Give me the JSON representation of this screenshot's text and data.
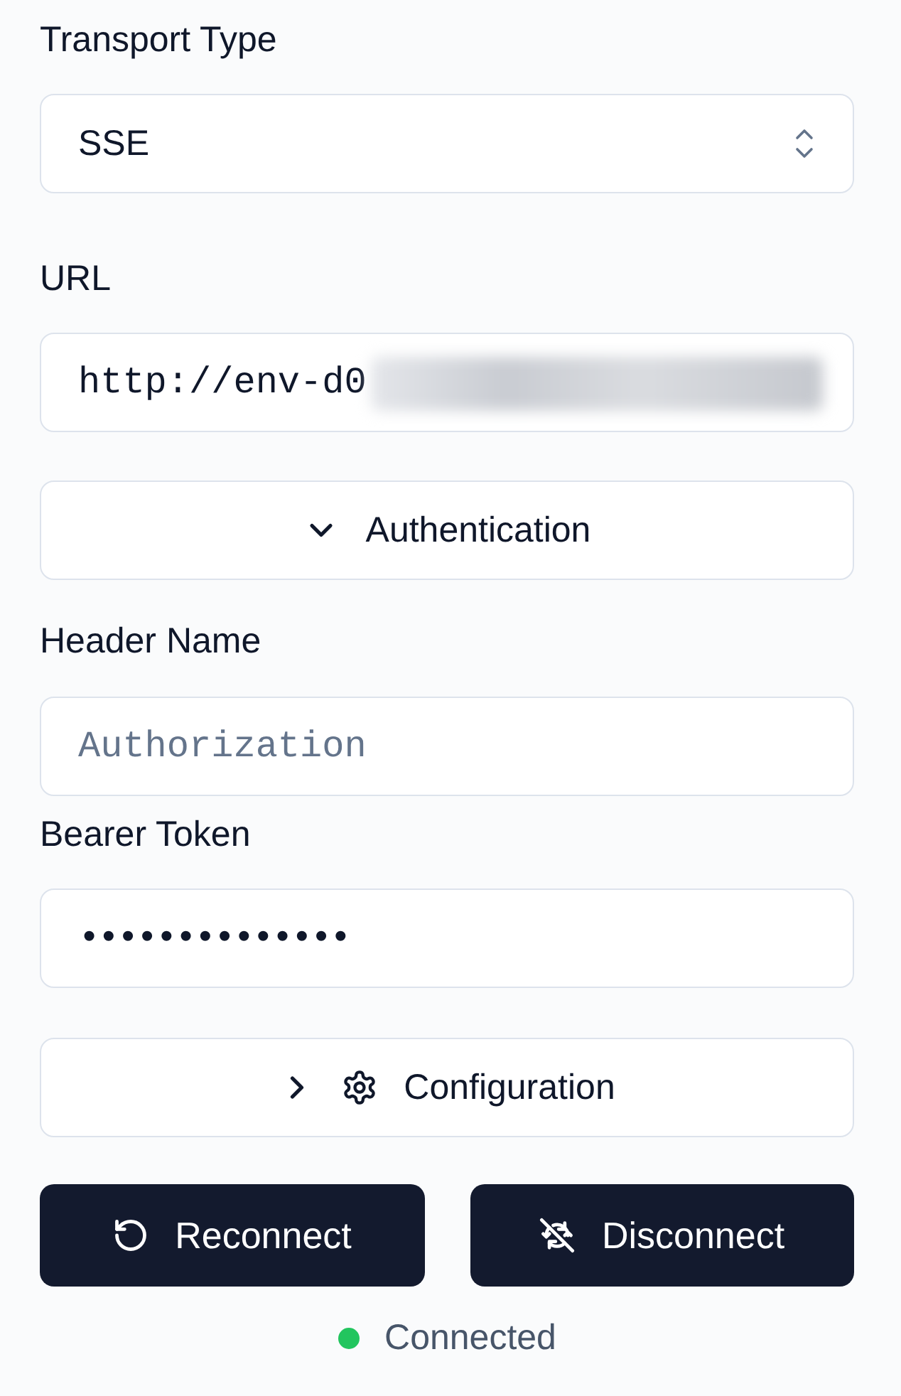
{
  "transport": {
    "label": "Transport Type",
    "value": "SSE"
  },
  "url": {
    "label": "URL",
    "value": "http://env-d0"
  },
  "authentication": {
    "label": "Authentication",
    "expanded": true
  },
  "header_name": {
    "label": "Header Name",
    "placeholder": "Authorization"
  },
  "bearer_token": {
    "label": "Bearer Token",
    "value": "••••••••••••••"
  },
  "configuration": {
    "label": "Configuration",
    "expanded": false
  },
  "buttons": [
    {
      "kind": "reconnect",
      "label": "Reconnect"
    },
    {
      "kind": "disconnect",
      "label": "Disconnect"
    }
  ],
  "status": {
    "label": "Connected",
    "color": "#22c55e"
  }
}
